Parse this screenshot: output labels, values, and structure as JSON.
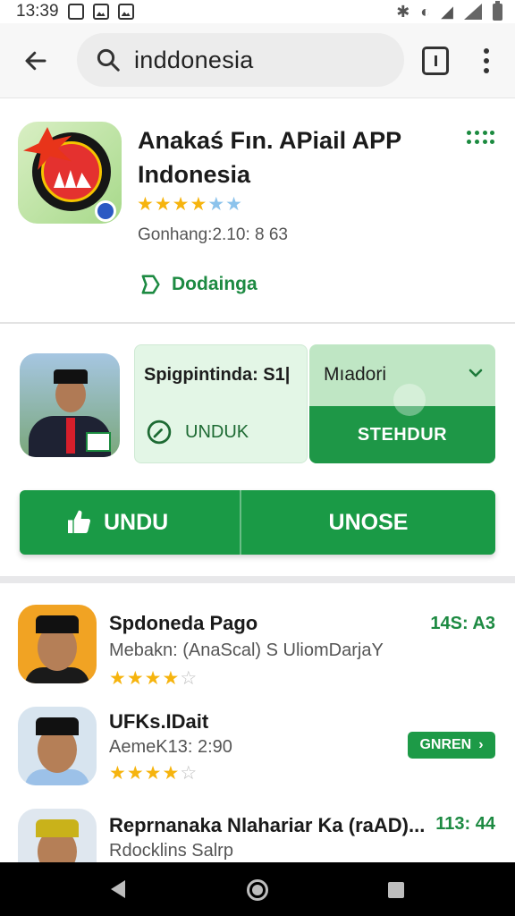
{
  "status_bar": {
    "time": "13:39",
    "icons": [
      "n-icon",
      "image-icon",
      "image-icon",
      "bluetooth-icon",
      "wifi-icon",
      "signal-icon",
      "battery-icon"
    ]
  },
  "search": {
    "query": "inddonesia",
    "icons": [
      "back-arrow-icon",
      "search-icon",
      "tab-icon",
      "more-vert-icon"
    ]
  },
  "featured_app": {
    "title": "Anakaś Fın. APiail APP Indonesia",
    "rating": 4.5,
    "meta": "Gonhang:2.10: 8 63",
    "link_label": "Dodainga"
  },
  "promo": {
    "left_card_label": "Spigpintinda: S1|",
    "left_card_action": "UNDUK",
    "right_card_label": "Mıadori",
    "right_card_button": "STEHDUR",
    "install_label": "UNDU",
    "open_label": "UNOSE"
  },
  "apps": [
    {
      "title": "Spdoneda Pago",
      "subtitle": "Mebakn: (AnaScal) S UliomDarjaY",
      "right_text": "14S: A3",
      "rating": 4
    },
    {
      "title": "UFKs.IDait",
      "subtitle": "AemeK13: 2:90",
      "right_chip": "GNREN",
      "rating": 4
    },
    {
      "title": "Reprnanaka Nlahariar Ka (raAD)...",
      "subtitle": "Rdocklins Salrp",
      "right_text": "113: 44"
    }
  ],
  "colors": {
    "accent_green": "#1a9a46",
    "link_green": "#1d8a42",
    "star_yellow": "#f6b40e"
  }
}
